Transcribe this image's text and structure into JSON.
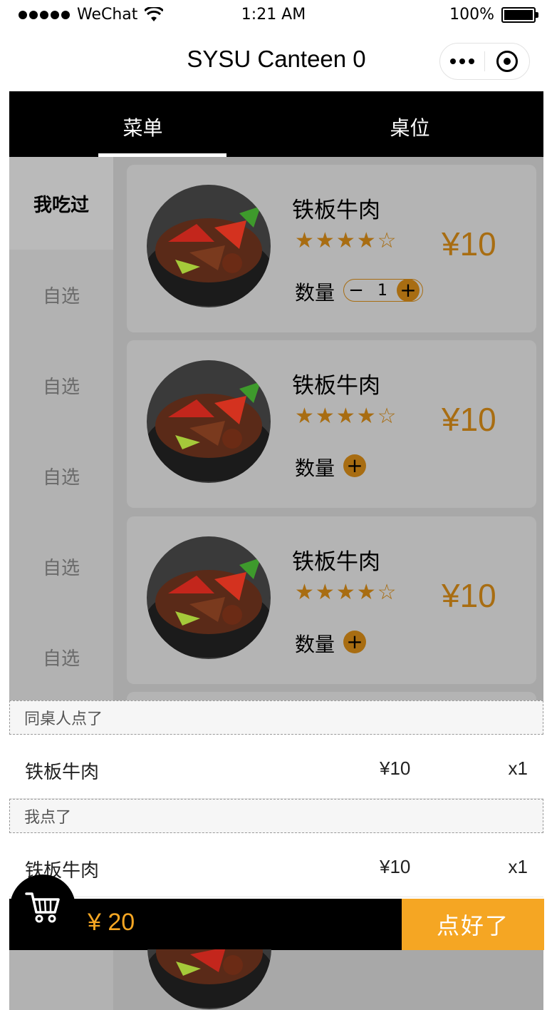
{
  "status_bar": {
    "carrier": "WeChat",
    "time": "1:21 AM",
    "battery": "100%"
  },
  "nav": {
    "title": "SYSU Canteen 0"
  },
  "tabs": [
    {
      "label": "菜单",
      "active": true
    },
    {
      "label": "桌位",
      "active": false
    }
  ],
  "sidebar": {
    "items": [
      {
        "label": "我吃过",
        "active": true
      },
      {
        "label": "自选"
      },
      {
        "label": "自选"
      },
      {
        "label": "自选"
      },
      {
        "label": "自选"
      },
      {
        "label": "自选"
      }
    ]
  },
  "dishes": [
    {
      "name": "铁板牛肉",
      "rating": 4,
      "max_rating": 5,
      "price": "¥10",
      "qty_label": "数量",
      "quantity": "1"
    },
    {
      "name": "铁板牛肉",
      "rating": 4,
      "max_rating": 5,
      "price": "¥10",
      "qty_label": "数量",
      "quantity": ""
    },
    {
      "name": "铁板牛肉",
      "rating": 4,
      "max_rating": 5,
      "price": "¥10",
      "qty_label": "数量",
      "quantity": ""
    }
  ],
  "cart": {
    "sections": [
      {
        "title": "同桌人点了",
        "items": [
          {
            "name": "铁板牛肉",
            "price": "¥10",
            "count": "x1"
          }
        ]
      },
      {
        "title": "我点了",
        "items": [
          {
            "name": "铁板牛肉",
            "price": "¥10",
            "count": "x1"
          }
        ]
      }
    ],
    "total": "¥ 20",
    "submit_label": "点好了"
  },
  "icons": {
    "cart": "cart-icon",
    "more": "more-dots-icon",
    "close": "target-icon",
    "wifi": "wifi-icon"
  },
  "colors": {
    "accent": "#f5a623",
    "price": "#a86d12",
    "tab_bar": "#000000"
  }
}
